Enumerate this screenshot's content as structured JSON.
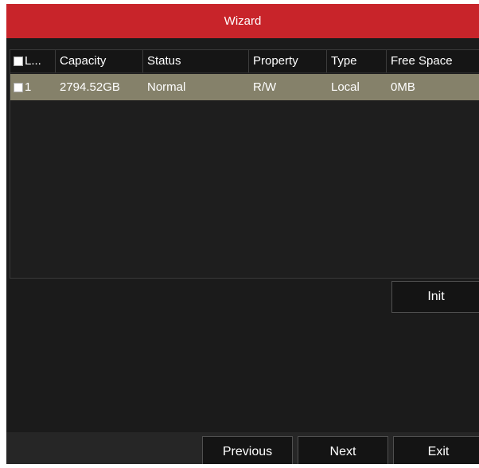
{
  "window": {
    "title": "Wizard"
  },
  "table": {
    "columns": [
      "L...",
      "Capacity",
      "Status",
      "Property",
      "Type",
      "Free Space"
    ],
    "rows": [
      {
        "label": "1",
        "capacity": "2794.52GB",
        "status": "Normal",
        "property": "R/W",
        "type": "Local",
        "free_space": "0MB",
        "selected": true
      }
    ]
  },
  "buttons": {
    "init": "Init",
    "previous": "Previous",
    "next": "Next",
    "exit": "Exit"
  },
  "colors": {
    "title_bar": "#c8242a",
    "selected_row": "#85816a",
    "background": "#1b1b1b"
  }
}
